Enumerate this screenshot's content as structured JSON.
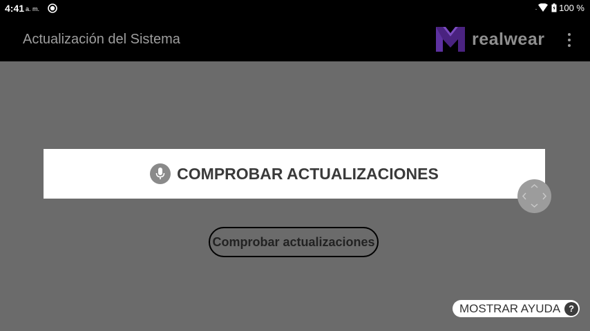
{
  "status_bar": {
    "time": "4:41",
    "ampm": "a. m.",
    "battery": "100 %",
    "icons": [
      "radio-icon",
      "wifi-icon",
      "battery-icon"
    ]
  },
  "app_bar": {
    "title": "Actualización del Sistema",
    "logo_text": "realwear",
    "icons": [
      "realwear-logo-icon",
      "more-vert-icon"
    ]
  },
  "banner": {
    "label": "COMPROBAR ACTUALIZACIONES",
    "icon": "mic-icon"
  },
  "check_button": {
    "label": "Comprobar actualizaciones"
  },
  "help_button": {
    "label": "MOSTRAR AYUDA",
    "icon_text": "?"
  },
  "nav_control": {
    "icon": "directional-pad-icon"
  },
  "colors": {
    "background": "#6b6b6b",
    "bar": "#000000",
    "logo_purple": "#5a2a91"
  }
}
